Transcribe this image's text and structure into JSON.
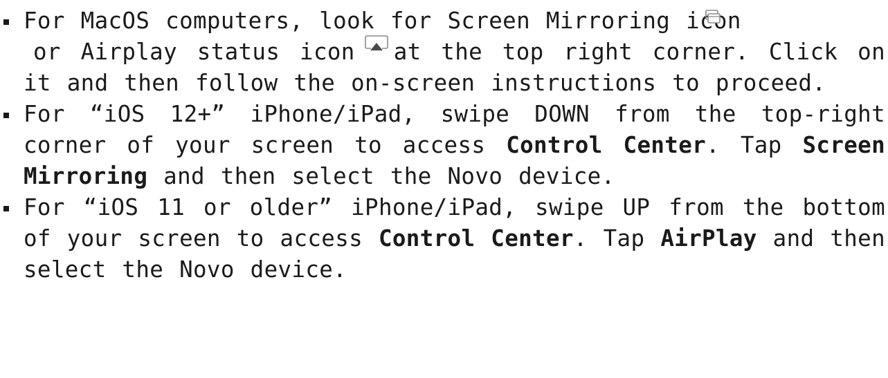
{
  "instructions": {
    "macos": {
      "part1": "For MacOS computers, look for Screen Mirroring icon",
      "part2": "or Airplay status icon",
      "part3": "at the top right corner. Click on it and then follow the on-screen instructions to proceed.",
      "icons": [
        "screen-mirroring-icon",
        "airplay-status-icon"
      ]
    },
    "ios12": {
      "part1": "For “iOS 12+” iPhone/iPad, swipe DOWN from the top-right corner of your screen to access ",
      "bold1": "Control Center",
      "part2": ". Tap ",
      "bold2": "Screen Mirroring",
      "part3": " and then select the Novo device."
    },
    "ios11": {
      "part1": "For “iOS 11 or older” iPhone/iPad, swipe UP from the bottom of your screen to access ",
      "bold1": "Control Center",
      "part2": ". Tap ",
      "bold2": "AirPlay",
      "part3": " and then select the Novo device."
    }
  },
  "colors": {
    "text": "#1a1a1a",
    "icon_stroke": "#8a8a8a",
    "airplay_triangle": "#4a4a4a"
  }
}
